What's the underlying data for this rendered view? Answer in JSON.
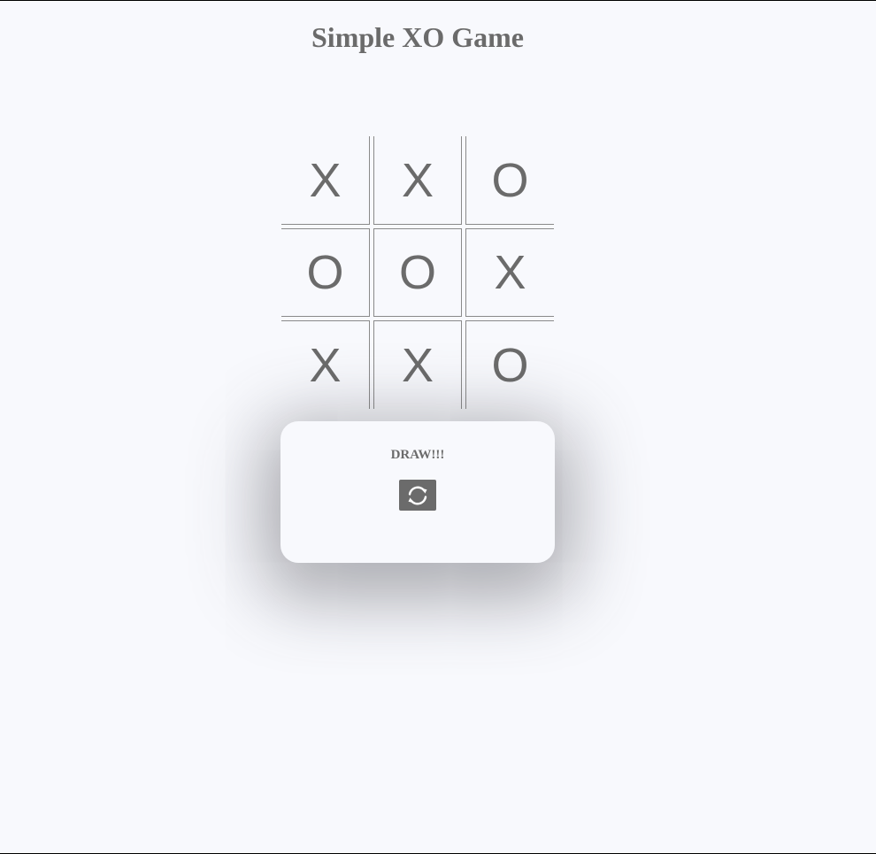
{
  "title": "Simple XO Game",
  "board": [
    [
      "X",
      "X",
      "O"
    ],
    [
      "O",
      "O",
      "X"
    ],
    [
      "X",
      "X",
      "O"
    ]
  ],
  "result": {
    "message": "DRAW!!!",
    "restart_icon": "refresh-icon"
  },
  "colors": {
    "background": "#f8f9fd",
    "text": "#6b6b6b",
    "grid_line": "#8a8a8a",
    "button": "#6b6b6b"
  }
}
